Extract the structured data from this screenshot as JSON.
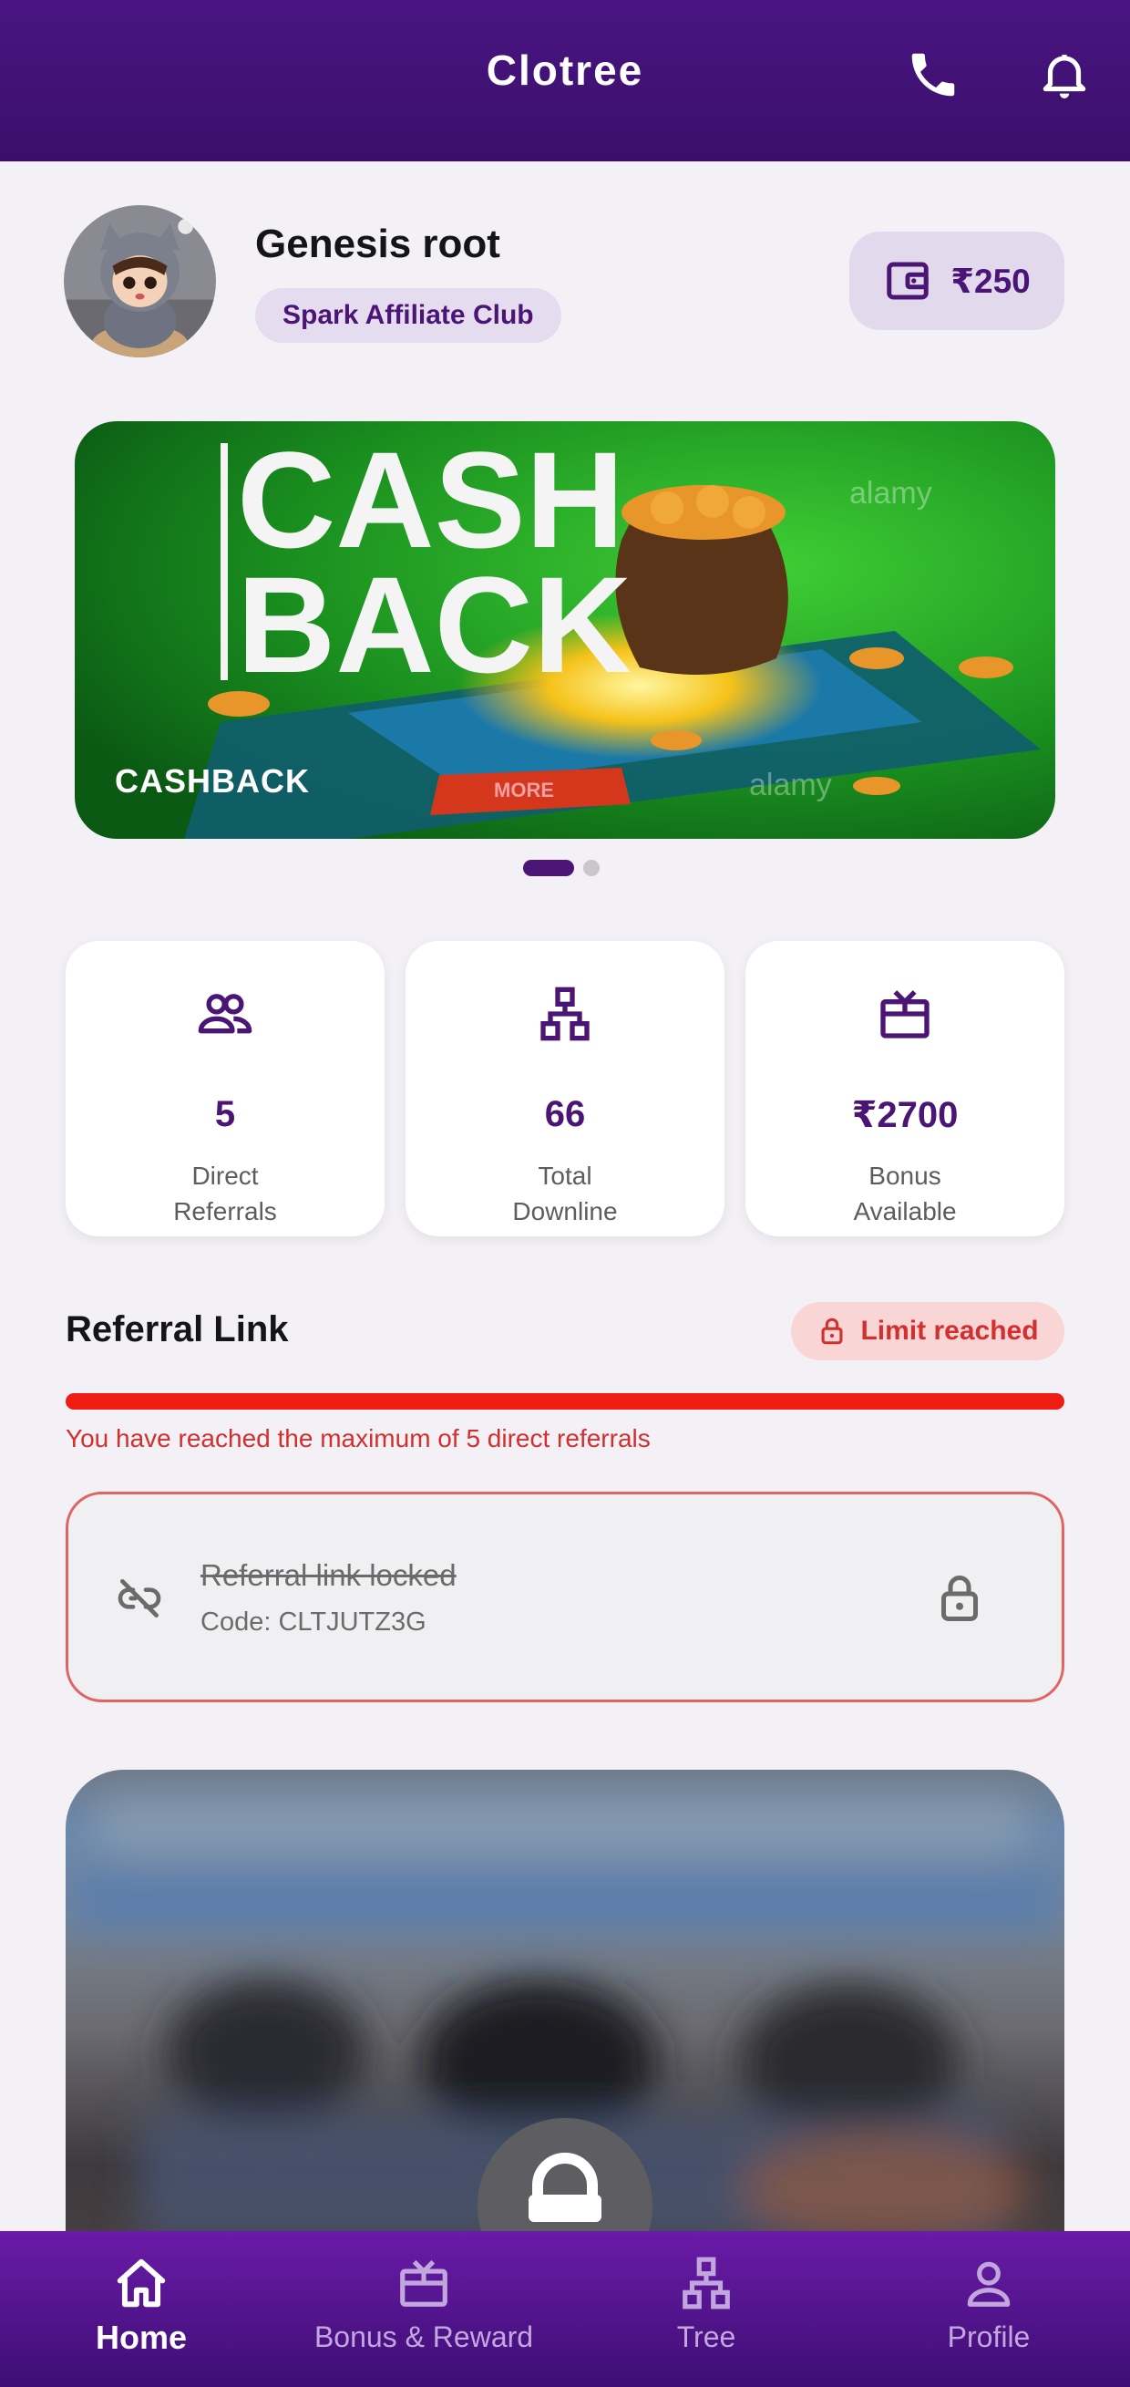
{
  "header": {
    "title": "Clotree",
    "phone_icon": "phone-icon",
    "bell_icon": "bell-icon"
  },
  "profile": {
    "name": "Genesis root",
    "club": "Spark Affiliate Club",
    "wallet_amount": "₹250"
  },
  "banner": {
    "caption": "CASHBACK",
    "headline_line1": "CASH",
    "headline_line2": "BACK",
    "button_text": "MORE",
    "watermark": "alamy",
    "active_slide": 1,
    "total_slides": 2
  },
  "stats": [
    {
      "icon": "people-icon",
      "value": "5",
      "label_line1": "Direct",
      "label_line2": "Referrals"
    },
    {
      "icon": "tree-icon",
      "value": "66",
      "label_line1": "Total",
      "label_line2": "Downline"
    },
    {
      "icon": "gift-icon",
      "value": "₹2700",
      "label_line1": "Bonus",
      "label_line2": "Available"
    }
  ],
  "referral": {
    "title": "Referral Link",
    "limit_badge": "Limit reached",
    "progress": 1.0,
    "message": "You have reached the maximum of 5 direct referrals",
    "locked_title": "Referral link locked",
    "code": "Code: CLTJUTZ3G"
  },
  "nav": [
    {
      "label": "Home",
      "icon": "home-icon",
      "active": true
    },
    {
      "label": "Bonus & Reward",
      "icon": "gift-icon",
      "active": false
    },
    {
      "label": "Tree",
      "icon": "tree-icon",
      "active": false
    },
    {
      "label": "Profile",
      "icon": "person-icon",
      "active": false
    }
  ],
  "colors": {
    "primary": "#4a1575",
    "header": "#3a0f6a",
    "error": "#d32f2f",
    "progress": "#f01d14"
  }
}
